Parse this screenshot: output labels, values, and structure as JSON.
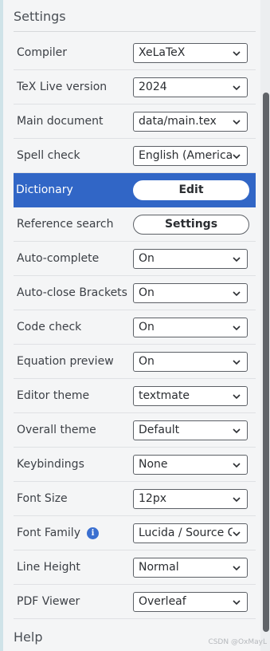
{
  "settings_title": "Settings",
  "help_title": "Help",
  "rows": [
    {
      "label": "Compiler",
      "control": "select",
      "value": "XeLaTeX"
    },
    {
      "label": "TeX Live version",
      "control": "select",
      "value": "2024"
    },
    {
      "label": "Main document",
      "control": "select",
      "value": "data/main.tex"
    },
    {
      "label": "Spell check",
      "control": "select",
      "value": "English (American)"
    },
    {
      "label": "Dictionary",
      "control": "button",
      "value": "Edit"
    },
    {
      "label": "Reference search",
      "control": "button",
      "value": "Settings"
    },
    {
      "label": "Auto-complete",
      "control": "select",
      "value": "On"
    },
    {
      "label": "Auto-close Brackets",
      "control": "select",
      "value": "On"
    },
    {
      "label": "Code check",
      "control": "select",
      "value": "On"
    },
    {
      "label": "Equation preview",
      "control": "select",
      "value": "On"
    },
    {
      "label": "Editor theme",
      "control": "select",
      "value": "textmate"
    },
    {
      "label": "Overall theme",
      "control": "select",
      "value": "Default"
    },
    {
      "label": "Keybindings",
      "control": "select",
      "value": "None"
    },
    {
      "label": "Font Size",
      "control": "select",
      "value": "12px"
    },
    {
      "label": "Font Family",
      "control": "select",
      "value": "Lucida / Source Code Pro"
    },
    {
      "label": "Line Height",
      "control": "select",
      "value": "Normal"
    },
    {
      "label": "PDF Viewer",
      "control": "select",
      "value": "Overleaf"
    }
  ],
  "info_icon_glyph": "i",
  "watermark": "CSDN @OxMayL",
  "colors": {
    "highlight": "#3166c6",
    "info_icon": "#3a6fd0"
  }
}
